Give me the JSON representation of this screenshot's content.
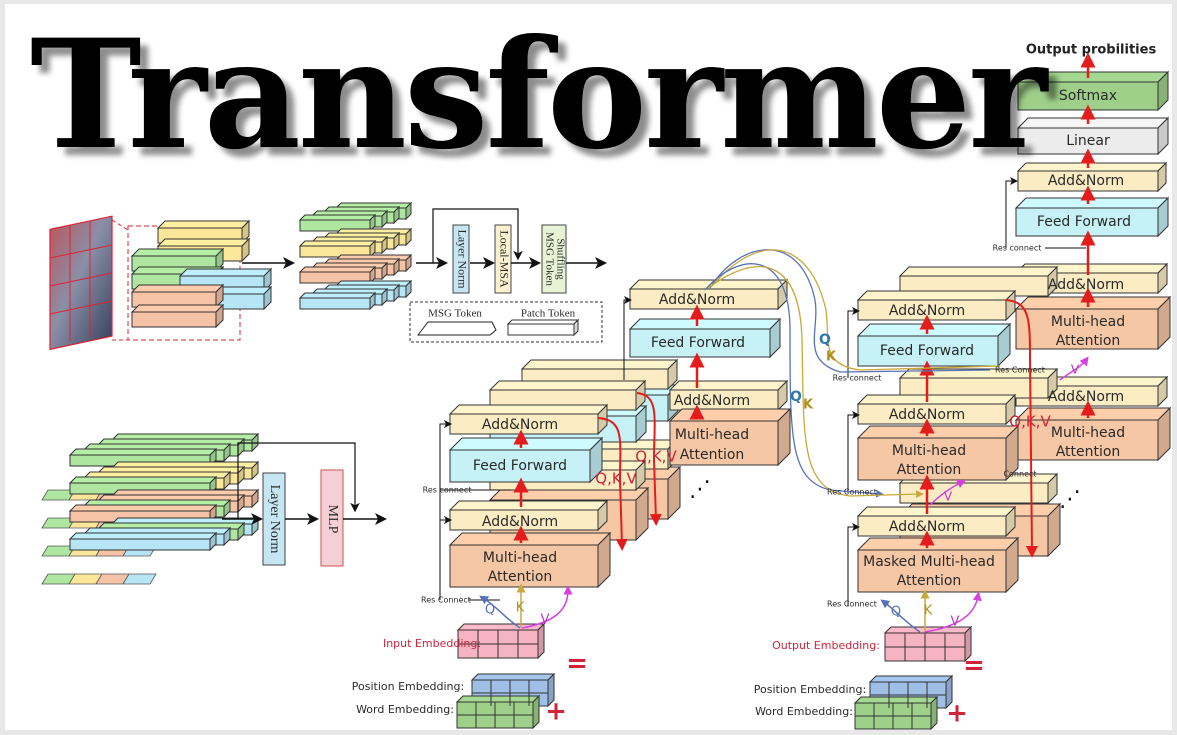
{
  "title": "Transformer",
  "output_label": "Output probilities",
  "decoder_top": {
    "softmax": "Softmax",
    "linear": "Linear",
    "add_norm": "Add&Norm",
    "feed_forward": "Feed Forward",
    "res_connect": "Res connect"
  },
  "msg_block": {
    "layer_norm": "Layer Norm",
    "local_msa": "Local-MSA",
    "shuffling": "MSG Token Shuffling",
    "legend": {
      "msg_token": "MSG Token",
      "patch_token": "Patch Token"
    }
  },
  "mlp_block": {
    "layer_norm": "Layer Norm",
    "mlp": "MLP"
  },
  "encoder": {
    "add_norm": "Add&Norm",
    "feed_forward": "Feed Forward",
    "multi_head": "Multi-head",
    "attention": "Attention",
    "res_connect": "Res connect",
    "res_connect_lower": "Res Connect",
    "qkv": "Q,K,V",
    "q": "Q",
    "k": "K",
    "v": "V",
    "ellipsis": "⋰"
  },
  "decoder": {
    "add_norm": "Add&Norm",
    "feed_forward": "Feed Forward",
    "multi_head": "Multi-head",
    "attention": "Attention",
    "masked_multi_head": "Masked Multi-head",
    "res_connect": "Res connect",
    "res_connect_lower": "Res Connect",
    "connect_partial": "Connect",
    "qkv": "Q,K,V",
    "q": "Q",
    "k": "K",
    "v": "V"
  },
  "embeddings": {
    "input": "Input Embedding:",
    "output": "Output Embedding:",
    "position": "Position Embedding:",
    "word": "Word Embedding:",
    "equals": "=",
    "plus": "+"
  },
  "colors": {
    "add_norm": "#fbecc4",
    "feed_forward": "#c5f1f7",
    "attention": "#f6c7a5",
    "softmax": "#9fd08a",
    "linear": "#ececec",
    "input_embedding": "#f6b3c2",
    "position_embedding": "#9fbfe6",
    "word_embedding": "#9fd08a",
    "red_arrow": "#e41c1c",
    "q_line": "#5873b8",
    "k_line": "#c9a93a",
    "v_line": "#d63fe0"
  }
}
